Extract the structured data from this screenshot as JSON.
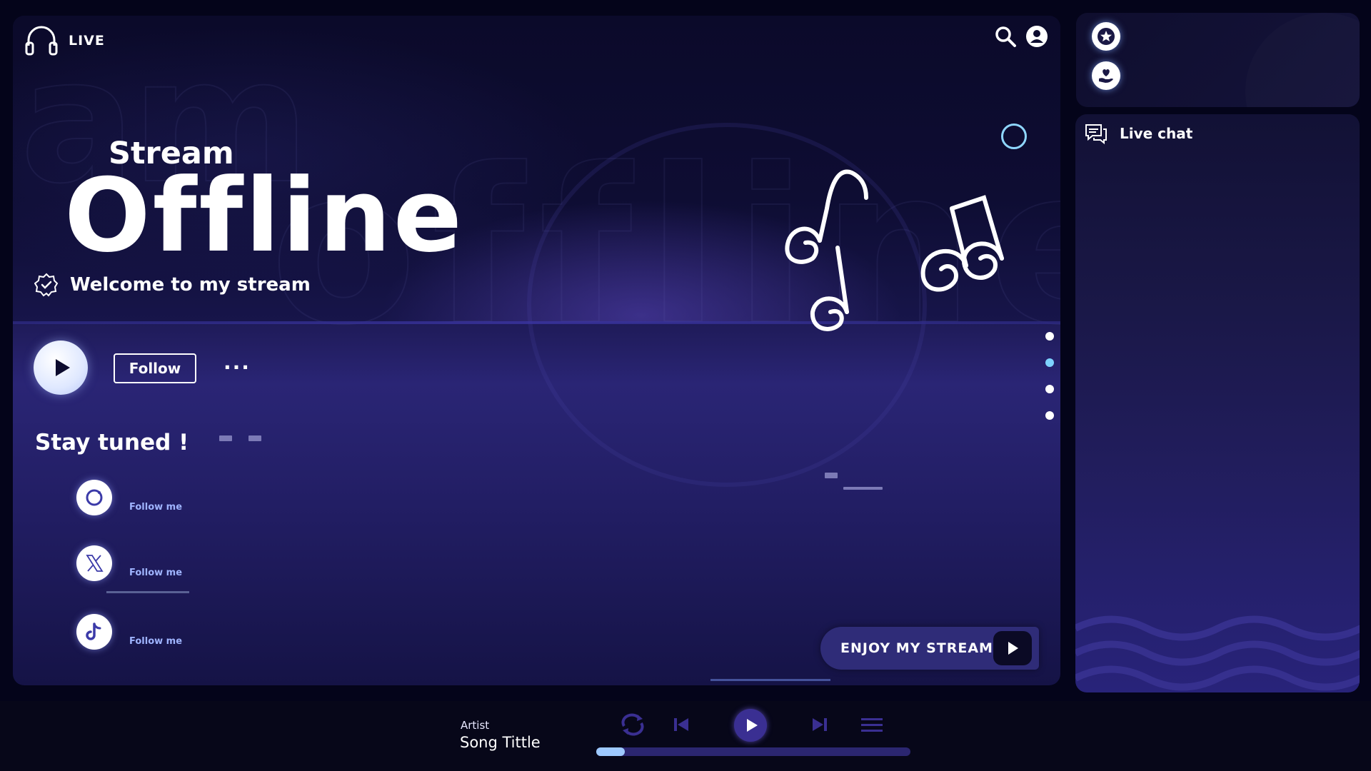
{
  "header": {
    "live_label": "LIVE",
    "icons": [
      "headphones-icon",
      "search-icon",
      "user-icon"
    ]
  },
  "hero": {
    "stream_label": "Stream",
    "offline_label": "Offline",
    "welcome_text": "Welcome to my stream",
    "ghost_text_left": "am",
    "ghost_text_right": "offline"
  },
  "actions": {
    "follow_label": "Follow",
    "more_label": "···"
  },
  "carousel": {
    "count": 4,
    "active_index": 1,
    "active_color": "#7ed3ff"
  },
  "socials": {
    "title": "Stay tuned !",
    "items": [
      {
        "icon": "instagram-icon",
        "label": "Follow me"
      },
      {
        "icon": "x-twitter-icon",
        "label": "Follow me"
      },
      {
        "icon": "tiktok-icon",
        "label": "Follow me"
      }
    ]
  },
  "cta": {
    "label": "ENJOY MY STREAM !",
    "icon": "play-icon"
  },
  "side": {
    "icons": [
      "star-icon",
      "heart-hand-icon"
    ]
  },
  "chat": {
    "title": "Live chat",
    "icon": "chat-icon"
  },
  "player": {
    "artist": "Artist",
    "song": "Song Tittle",
    "controls": [
      "repeat-icon",
      "previous-icon",
      "play-icon",
      "next-icon",
      "playlist-icon"
    ],
    "progress": 0.09
  },
  "colors": {
    "background": "#04041a",
    "panel_dark": "#0c0b2e",
    "panel_accent": "#2a2575",
    "accent_blue": "#7ed3ff",
    "cta_bg": "#2f2c78",
    "player_play": "#3a2f92",
    "progress_fill": "#9ec9ff"
  }
}
